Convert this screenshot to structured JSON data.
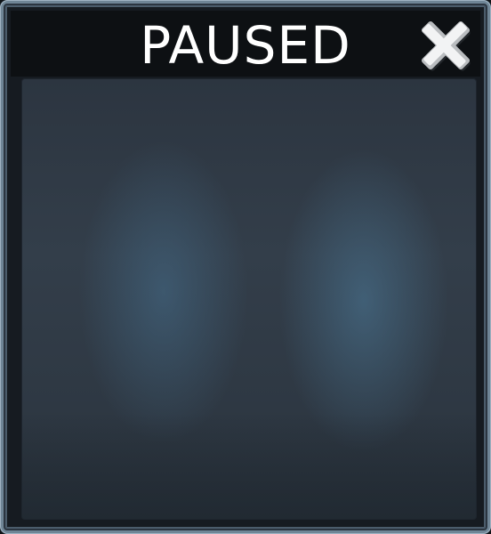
{
  "dialog": {
    "title": "PAUSED",
    "close_icon": "close-icon"
  },
  "colors": {
    "frame": "#6f8596",
    "title_bar": "#0d1013",
    "title_text": "#ffffff",
    "content_bg": "#333e4a",
    "content_glow": "#4b7694"
  }
}
